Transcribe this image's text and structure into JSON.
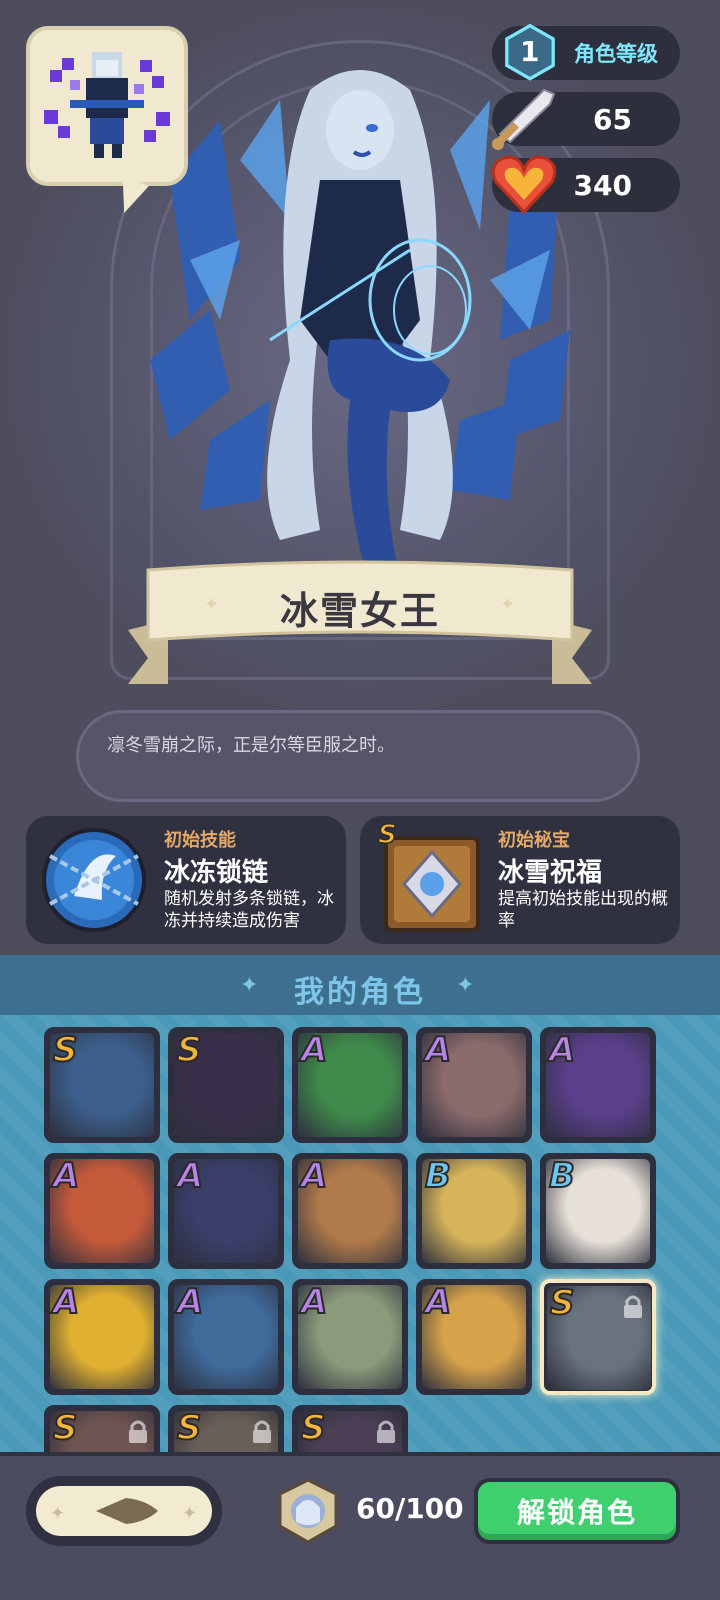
{
  "hero": {
    "character_name": "冰雪女王",
    "quote": "凛冬雪崩之际，正是尔等臣服之时。",
    "level": "1",
    "level_label": "角色等级",
    "attack": "65",
    "hp": "340"
  },
  "skills": {
    "starting_skill": {
      "caption": "初始技能",
      "name": "冰冻锁链",
      "description": "随机发射多条锁链，冰冻并持续造成伤害"
    },
    "starting_treasure": {
      "grade": "S",
      "caption": "初始秘宝",
      "name": "冰雪祝福",
      "description": "提高初始技能出现的概率"
    }
  },
  "roster": {
    "title": "我的角色",
    "tiles": [
      {
        "grade": "S",
        "color": "#3b5e8a",
        "locked": false,
        "selected": false
      },
      {
        "grade": "S",
        "color": "#3a2f4a",
        "locked": false,
        "selected": false
      },
      {
        "grade": "A",
        "color": "#3f8a4a",
        "locked": false,
        "selected": false
      },
      {
        "grade": "A",
        "color": "#8a6a6a",
        "locked": false,
        "selected": false
      },
      {
        "grade": "A",
        "color": "#5a3f8a",
        "locked": false,
        "selected": false
      },
      {
        "grade": "A",
        "color": "#c55a3a",
        "locked": false,
        "selected": false
      },
      {
        "grade": "A",
        "color": "#3a3f6a",
        "locked": false,
        "selected": false
      },
      {
        "grade": "A",
        "color": "#b07a4a",
        "locked": false,
        "selected": false
      },
      {
        "grade": "B",
        "color": "#d6b45a",
        "locked": false,
        "selected": false
      },
      {
        "grade": "B",
        "color": "#e6e0d6",
        "locked": false,
        "selected": false
      },
      {
        "grade": "A",
        "color": "#e0b030",
        "locked": false,
        "selected": false
      },
      {
        "grade": "A",
        "color": "#3f6a9a",
        "locked": false,
        "selected": false
      },
      {
        "grade": "A",
        "color": "#8a9a7a",
        "locked": false,
        "selected": false
      },
      {
        "grade": "A",
        "color": "#d6a24a",
        "locked": false,
        "selected": false
      },
      {
        "grade": "S",
        "color": "#8aa2b8",
        "locked": true,
        "selected": true
      },
      {
        "grade": "S",
        "color": "#b06a5a",
        "locked": true,
        "selected": false
      },
      {
        "grade": "S",
        "color": "#a08060",
        "locked": true,
        "selected": false
      },
      {
        "grade": "S",
        "color": "#6a4a7a",
        "locked": true,
        "selected": false
      }
    ]
  },
  "footer": {
    "count": "60/100",
    "unlock_label": "解锁角色"
  },
  "colors": {
    "grade_S": "#f5b43a",
    "grade_A": "#b884e6",
    "grade_B": "#6ec6f0",
    "accent_green": "#3fcf6e"
  }
}
